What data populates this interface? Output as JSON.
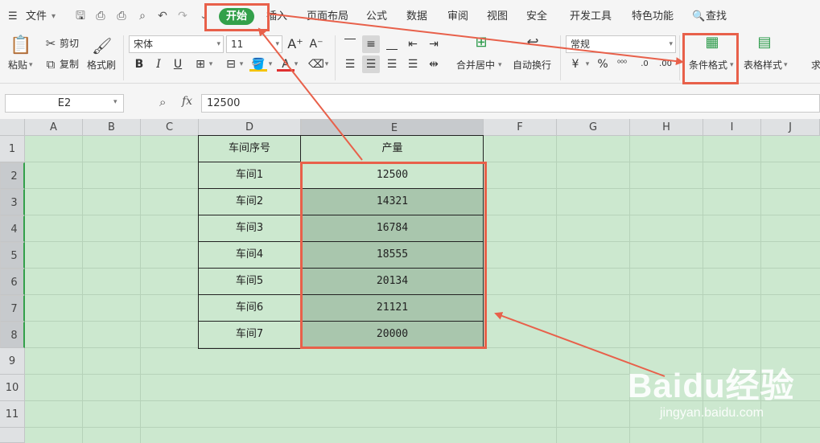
{
  "menubar": {
    "file": "文件",
    "tabs": [
      {
        "label": "开始"
      },
      {
        "label": "插入"
      },
      {
        "label": "页面布局"
      },
      {
        "label": "公式"
      },
      {
        "label": "数据"
      },
      {
        "label": "审阅"
      },
      {
        "label": "视图"
      },
      {
        "label": "安全"
      },
      {
        "label": "开发工具"
      },
      {
        "label": "特色功能"
      }
    ],
    "search": "查找"
  },
  "ribbon": {
    "paste": "粘贴",
    "cut": "剪切",
    "copy": "复制",
    "format_painter": "格式刷",
    "font_name": "宋体",
    "font_size": "11",
    "merge_center": "合并居中",
    "auto_wrap": "自动换行",
    "number_format": "常规",
    "conditional_format": "条件格式",
    "table_style": "表格样式",
    "sum_partial": "求"
  },
  "formula_bar": {
    "name_box": "E2",
    "fx": "fx",
    "value": "12500"
  },
  "sheet": {
    "columns": [
      "A",
      "B",
      "C",
      "D",
      "E",
      "F",
      "G",
      "H",
      "I",
      "J"
    ],
    "rows": [
      "1",
      "2",
      "3",
      "4",
      "5",
      "6",
      "7",
      "8",
      "9",
      "10",
      "11"
    ],
    "header_d": "车间序号",
    "header_e": "产量",
    "workshops": [
      "车间1",
      "车间2",
      "车间3",
      "车间4",
      "车间5",
      "车间6",
      "车间7"
    ],
    "outputs": [
      "12500",
      "14321",
      "16784",
      "18555",
      "20134",
      "21121",
      "20000"
    ]
  },
  "watermark": {
    "logo_text": "Baidu经验",
    "url": "jingyan.baidu.com"
  },
  "colors": {
    "accent_green": "#33a04a",
    "annotation_red": "#e8604a",
    "sheet_bg": "#cce8cf",
    "selection_fill": "#a9c6ad"
  }
}
